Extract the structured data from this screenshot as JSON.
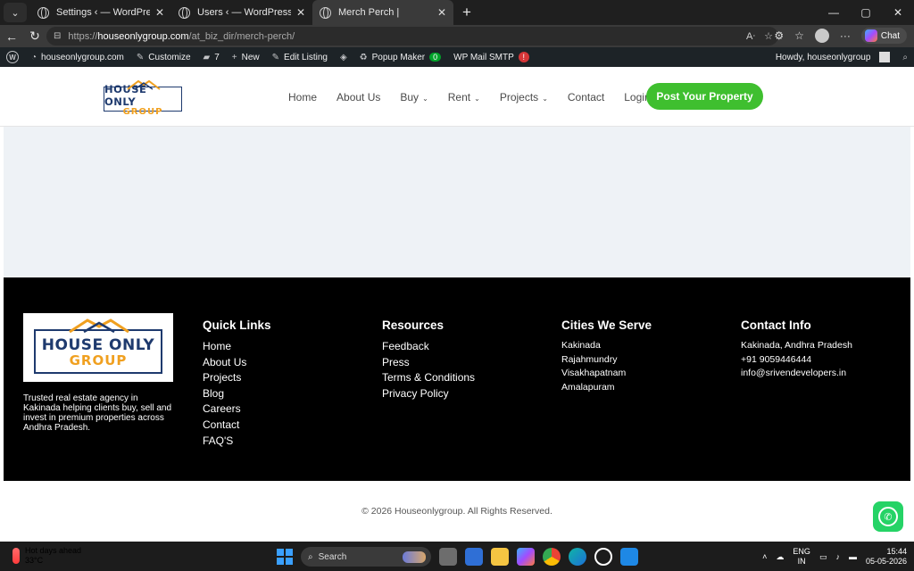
{
  "browser": {
    "tabs": [
      {
        "label": "Settings ‹ — WordPress",
        "active": false
      },
      {
        "label": "Users ‹ — WordPress",
        "active": false
      },
      {
        "label": "Merch Perch |",
        "active": true
      }
    ],
    "url_prefix": "https://",
    "url_host": "houseonlygroup.com",
    "url_path": "/at_biz_dir/merch-perch/",
    "chat_label": "Chat"
  },
  "wp_admin_bar": {
    "site_name": "houseonlygroup.com",
    "customize": "Customize",
    "comments_count": "7",
    "new_label": "New",
    "edit_listing": "Edit Listing",
    "popup_maker": "Popup Maker",
    "popup_maker_badge": "0",
    "wp_mail_smtp": "WP Mail SMTP",
    "wp_mail_badge": "!",
    "howdy": "Howdy, houseonlygroup"
  },
  "site": {
    "logo_line1": "HOUSE ONLY",
    "logo_line2": "GROUP",
    "nav": [
      {
        "label": "Home",
        "dropdown": false
      },
      {
        "label": "About Us",
        "dropdown": false
      },
      {
        "label": "Buy",
        "dropdown": true
      },
      {
        "label": "Rent",
        "dropdown": true
      },
      {
        "label": "Projects",
        "dropdown": true
      },
      {
        "label": "Contact",
        "dropdown": false
      },
      {
        "label": "Login",
        "dropdown": false
      }
    ],
    "cta": "Post Your Property",
    "brand_colors": {
      "navy": "#1e3a6e",
      "orange": "#f0a020",
      "green": "#3fbf2f"
    }
  },
  "footer": {
    "description": "Trusted real estate agency in Kakinada helping clients buy, sell and invest in premium properties across Andhra Pradesh.",
    "quick_links": {
      "title": "Quick Links",
      "items": [
        "Home",
        "About Us",
        "Projects",
        "Blog",
        "Careers",
        "Contact",
        "FAQ'S"
      ]
    },
    "resources": {
      "title": "Resources",
      "items": [
        "Feedback",
        "Press",
        "Terms & Conditions",
        "Privacy Policy"
      ]
    },
    "cities": {
      "title": "Cities We Serve",
      "items": [
        "Kakinada",
        "Rajahmundry",
        "Visakhapatnam",
        "Amalapuram"
      ]
    },
    "contact": {
      "title": "Contact Info",
      "items": [
        "Kakinada, Andhra Pradesh",
        "+91 9059446444",
        "info@srivendevelopers.in"
      ]
    },
    "copyright": "© 2026 Houseonlygroup. All Rights Reserved."
  },
  "taskbar": {
    "weather_title": "Hot days ahead",
    "weather_temp": "33°C",
    "search_label": "Search",
    "lang_line1": "ENG",
    "lang_line2": "IN",
    "time": "15:44",
    "date": "05-05-2026"
  }
}
